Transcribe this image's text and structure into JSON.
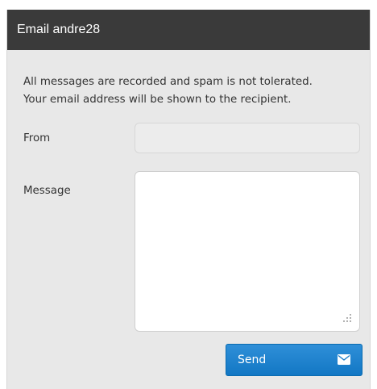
{
  "header": {
    "title": "Email andre28"
  },
  "notice": {
    "line1": "All messages are recorded and spam is not tolerated.",
    "line2": "Your email address will be shown to the recipient."
  },
  "form": {
    "from_label": "From",
    "from_value": "",
    "message_label": "Message",
    "message_value": "",
    "send_label": "Send"
  },
  "icons": {
    "send": "mail-icon",
    "grip": "resize-grip-icon"
  },
  "colors": {
    "header_bg": "#3a3a3a",
    "panel_bg": "#e8e8e8",
    "accent": "#1a7fcf"
  }
}
